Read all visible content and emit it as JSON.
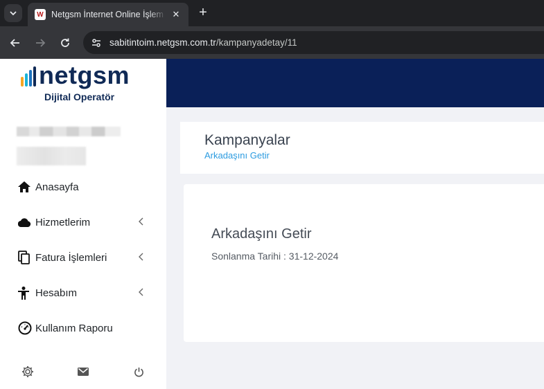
{
  "browser": {
    "tab_title": "Netgsm İnternet Online İşlem Merkezi",
    "favicon_letter": "W",
    "close_glyph": "✕",
    "new_tab_glyph": "+",
    "url_host": "sabitintoim.netgsm.com.tr",
    "url_path": "/kampanyadetay/11"
  },
  "brand": {
    "logo_text": "netgsm",
    "logo_subtitle": "Dijital Operatör",
    "bar_colors": [
      "#f5a623",
      "#19b3d8",
      "#1e73be",
      "#102a56"
    ]
  },
  "sidebar": {
    "items": [
      {
        "label": "Anasayfa",
        "icon": "home-icon",
        "has_submenu": false
      },
      {
        "label": "Hizmetlerim",
        "icon": "cloud-icon",
        "has_submenu": true
      },
      {
        "label": "Fatura İşlemleri",
        "icon": "copy-icon",
        "has_submenu": true
      },
      {
        "label": "Hesabım",
        "icon": "person-icon",
        "has_submenu": true
      },
      {
        "label": "Kullanım Raporu",
        "icon": "gauge-icon",
        "has_submenu": false
      }
    ],
    "footer_icons": [
      "settings-icon",
      "mail-icon",
      "power-icon"
    ]
  },
  "header": {
    "title": "Kampanyalar",
    "breadcrumb": "Arkadaşını Getir"
  },
  "campaign": {
    "title": "Arkadaşını Getir",
    "end_date_text": "Sonlanma Tarihi : 31-12-2024"
  },
  "colors": {
    "topbar": "#0a2058",
    "link": "#2b9be0",
    "brand_navy": "#102a56"
  }
}
